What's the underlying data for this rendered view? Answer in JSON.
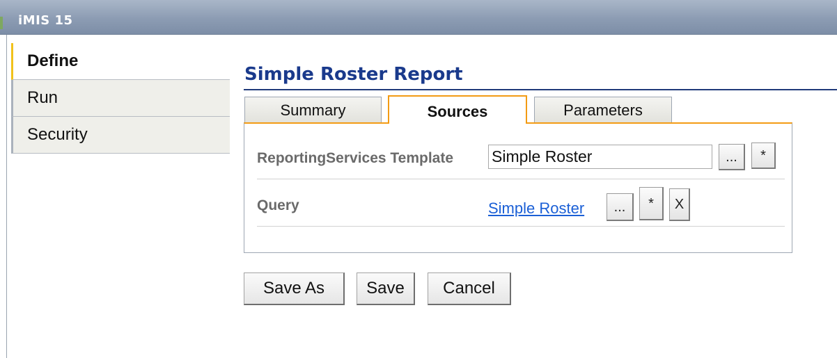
{
  "window": {
    "title": "iMIS 15"
  },
  "sidebar": {
    "items": [
      {
        "label": "Define",
        "active": true
      },
      {
        "label": "Run",
        "active": false
      },
      {
        "label": "Security",
        "active": false
      }
    ]
  },
  "page": {
    "title": "Simple Roster Report"
  },
  "tabs": [
    {
      "label": "Summary",
      "active": false
    },
    {
      "label": "Sources",
      "active": true
    },
    {
      "label": "Parameters",
      "active": false
    }
  ],
  "sources": {
    "template": {
      "label": "ReportingServices Template",
      "value": "Simple Roster",
      "browse_label": "...",
      "clear_label": "*"
    },
    "query": {
      "label": "Query",
      "link_text": "Simple Roster",
      "browse_label": "...",
      "clear_label": "*",
      "remove_label": "X"
    }
  },
  "actions": {
    "save_as_label": "Save As",
    "save_label": "Save",
    "cancel_label": "Cancel"
  },
  "colors": {
    "title_text": "#1a3a8c",
    "active_tab_border": "#f39b14",
    "active_nav_marker": "#f1c21b",
    "link": "#1a5fd6"
  }
}
